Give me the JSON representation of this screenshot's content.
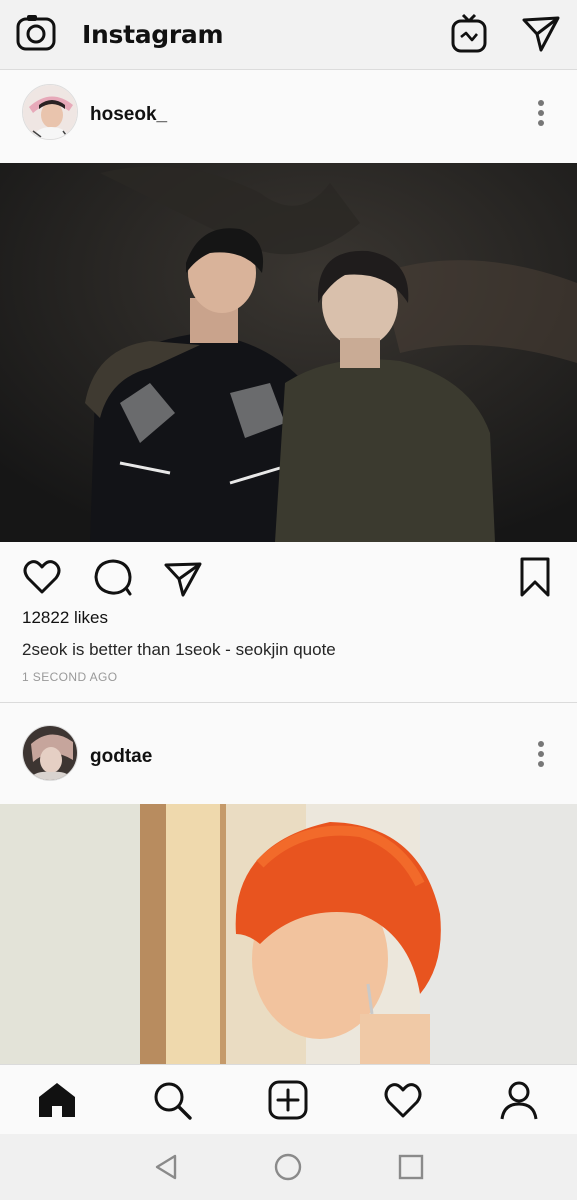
{
  "app": {
    "title": "Instagram"
  },
  "posts": [
    {
      "username": "hoseok_",
      "likes": "12822 likes",
      "caption": "2seok is better than 1seok - seokjin quote",
      "time": "1 SECOND AGO"
    },
    {
      "username": "godtae"
    }
  ],
  "icons": {
    "top": [
      "camera-icon",
      "igtv-icon",
      "direct-message-icon"
    ],
    "post_actions": [
      "heart-icon",
      "comment-icon",
      "share-icon",
      "bookmark-icon"
    ],
    "bottom_nav": [
      "home-icon",
      "search-icon",
      "add-post-icon",
      "activity-heart-icon",
      "profile-icon"
    ],
    "system_nav": [
      "back-icon",
      "home-circle-icon",
      "recents-icon"
    ]
  },
  "colors": {
    "background": "#fafafa",
    "text": "#262626",
    "muted": "#999999",
    "divider": "#dbdbdb"
  }
}
